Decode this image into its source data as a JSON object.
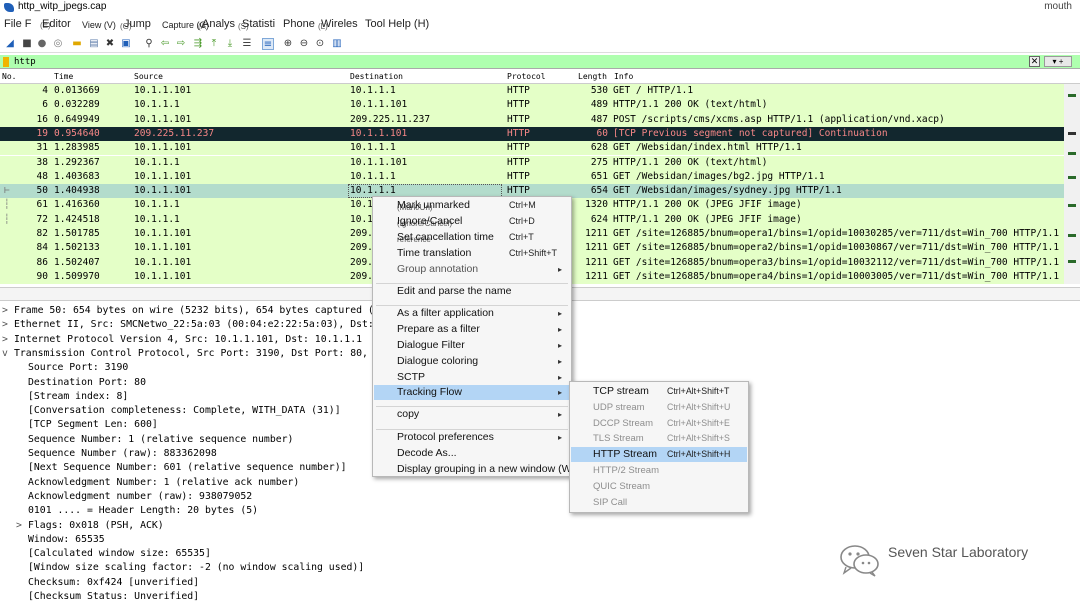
{
  "window": {
    "title": "http_witp_jpegs.cap",
    "right_text": "mouth"
  },
  "menu": [
    "File F",
    "Editor",
    "Jump",
    "Capture (C)",
    "Analys",
    "Statisti",
    "Phone",
    "Wireles",
    "Tool Help (H)"
  ],
  "menu_ghost": [
    "(E)",
    "View (V)",
    "(G)",
    "(A)",
    "(S)",
    "(L)"
  ],
  "filter": {
    "value": "http"
  },
  "columns": {
    "no": "No.",
    "time": "Time",
    "source": "Source",
    "destination": "Destination",
    "protocol": "Protocol",
    "length": "Length",
    "info": "Info"
  },
  "packets": [
    {
      "no": "4",
      "time": "0.013669",
      "src": "10.1.1.101",
      "dst": "10.1.1.1",
      "proto": "HTTP",
      "len": "530",
      "info": "GET / HTTP/1.1"
    },
    {
      "no": "6",
      "time": "0.032289",
      "src": "10.1.1.1",
      "dst": "10.1.1.101",
      "proto": "HTTP",
      "len": "489",
      "info": "HTTP/1.1 200 OK  (text/html)"
    },
    {
      "no": "16",
      "time": "0.649949",
      "src": "10.1.1.101",
      "dst": "209.225.11.237",
      "proto": "HTTP",
      "len": "487",
      "info": "POST /scripts/cms/xcms.asp HTTP/1.1  (application/vnd.xacp)"
    },
    {
      "no": "19",
      "time": "0.954640",
      "src": "209.225.11.237",
      "dst": "10.1.1.101",
      "proto": "HTTP",
      "len": "60",
      "info": "[TCP Previous segment not captured] Continuation"
    },
    {
      "no": "31",
      "time": "1.283985",
      "src": "10.1.1.101",
      "dst": "10.1.1.1",
      "proto": "HTTP",
      "len": "628",
      "info": "GET /Websidan/index.html HTTP/1.1"
    },
    {
      "no": "38",
      "time": "1.292367",
      "src": "10.1.1.1",
      "dst": "10.1.1.101",
      "proto": "HTTP",
      "len": "275",
      "info": "HTTP/1.1 200 OK  (text/html)"
    },
    {
      "no": "48",
      "time": "1.403683",
      "src": "10.1.1.101",
      "dst": "10.1.1.1",
      "proto": "HTTP",
      "len": "651",
      "info": "GET /Websidan/images/bg2.jpg HTTP/1.1"
    },
    {
      "no": "50",
      "time": "1.404938",
      "src": "10.1.1.101",
      "dst": "10.1.1.1",
      "proto": "HTTP",
      "len": "654",
      "info": "GET /Websidan/images/sydney.jpg HTTP/1.1"
    },
    {
      "no": "61",
      "time": "1.416360",
      "src": "10.1.1.1",
      "dst": "10.1",
      "proto": "",
      "len": "1320",
      "info": "HTTP/1.1 200 OK  (JPEG JFIF image)"
    },
    {
      "no": "72",
      "time": "1.424518",
      "src": "10.1.1.1",
      "dst": "10.1",
      "proto": "",
      "len": "624",
      "info": "HTTP/1.1 200 OK  (JPEG JFIF image)"
    },
    {
      "no": "82",
      "time": "1.501785",
      "src": "10.1.1.101",
      "dst": "209.",
      "proto": "",
      "len": "1211",
      "info": "GET /site=126885/bnum=opera1/bins=1/opid=10030285/ver=711/dst=Win_700 HTTP/1.1"
    },
    {
      "no": "84",
      "time": "1.502133",
      "src": "10.1.1.101",
      "dst": "209.",
      "proto": "",
      "len": "1211",
      "info": "GET /site=126885/bnum=opera2/bins=1/opid=10030867/ver=711/dst=Win_700 HTTP/1.1"
    },
    {
      "no": "86",
      "time": "1.502407",
      "src": "10.1.1.101",
      "dst": "209.",
      "proto": "",
      "len": "1211",
      "info": "GET /site=126885/bnum=opera3/bins=1/opid=10032112/ver=711/dst=Win_700 HTTP/1.1"
    },
    {
      "no": "90",
      "time": "1.509970",
      "src": "10.1.1.101",
      "dst": "209.",
      "proto": "",
      "len": "1211",
      "info": "GET /site=126885/bnum=opera4/bins=1/opid=10003005/ver=711/dst=Win_700 HTTP/1.1"
    }
  ],
  "details": [
    {
      "tw": ">",
      "text": "Frame 50: 654 bytes on wire (5232 bits), 654 bytes captured (5.",
      "indent": 0
    },
    {
      "tw": ">",
      "text": "Ethernet II, Src: SMCNetwo_22:5a:03 (00:04:e2:22:5a:03), Dst: N",
      "indent": 0
    },
    {
      "tw": ">",
      "text": "Internet Protocol Version 4, Src: 10.1.1.101, Dst: 10.1.1.1",
      "indent": 0
    },
    {
      "tw": "v",
      "text": "Transmission Control Protocol, Src Port: 3190, Dst Port: 80, Se",
      "indent": 0
    },
    {
      "tw": "",
      "text": "Source Port: 3190",
      "indent": 1
    },
    {
      "tw": "",
      "text": "Destination Port: 80",
      "indent": 1
    },
    {
      "tw": "",
      "text": "[Stream index: 8]",
      "indent": 1
    },
    {
      "tw": "",
      "text": "[Conversation completeness: Complete, WITH_DATA (31)]",
      "indent": 1
    },
    {
      "tw": "",
      "text": "[TCP Segment Len: 600]",
      "indent": 1
    },
    {
      "tw": "",
      "text": "Sequence Number: 1    (relative sequence number)",
      "indent": 1
    },
    {
      "tw": "",
      "text": "Sequence Number (raw): 883362098",
      "indent": 1
    },
    {
      "tw": "",
      "text": "[Next Sequence Number: 601    (relative sequence number)]",
      "indent": 1
    },
    {
      "tw": "",
      "text": "Acknowledgment Number: 1    (relative ack number)",
      "indent": 1
    },
    {
      "tw": "",
      "text": "Acknowledgment number (raw): 938079052",
      "indent": 1
    },
    {
      "tw": "",
      "text": "0101 .... = Header Length: 20 bytes (5)",
      "indent": 1
    },
    {
      "tw": ">",
      "text": "Flags: 0x018 (PSH, ACK)",
      "indent": 1
    },
    {
      "tw": "",
      "text": "Window: 65535",
      "indent": 1
    },
    {
      "tw": "",
      "text": "[Calculated window size: 65535]",
      "indent": 1
    },
    {
      "tw": "",
      "text": "[Window size scaling factor: -2 (no window scaling used)]",
      "indent": 1
    },
    {
      "tw": "",
      "text": "Checksum: 0xf424 [unverified]",
      "indent": 1
    },
    {
      "tw": "",
      "text": "[Checksum Status: Unverified]",
      "indent": 1
    }
  ],
  "context_menu": [
    {
      "label": "Mark unmarked",
      "shortcut": "Ctrl+M"
    },
    {
      "label": "Ignore/Cancel",
      "shortcut": "Ctrl+D"
    },
    {
      "label": "Set cancellation time",
      "shortcut": "Ctrl+T"
    },
    {
      "label": "Time translation",
      "shortcut": "Ctrl+Shift+T"
    },
    {
      "label": "Group annotation",
      "shortcut": "",
      "submenu": true
    },
    {
      "label": "Edit and parse the name",
      "shortcut": ""
    },
    {
      "label": "As a filter application",
      "shortcut": "",
      "submenu": true
    },
    {
      "label": "Prepare as a filter",
      "shortcut": "",
      "submenu": true
    },
    {
      "label": "Dialogue Filter",
      "shortcut": "",
      "submenu": true
    },
    {
      "label": "Dialogue coloring",
      "shortcut": "",
      "submenu": true
    },
    {
      "label": "SCTP",
      "shortcut": "",
      "submenu": true
    },
    {
      "label": "Tracking Flow",
      "shortcut": "",
      "submenu": true
    },
    {
      "label": "copy",
      "shortcut": "",
      "submenu": true
    },
    {
      "label": "Protocol preferences",
      "shortcut": "",
      "submenu": true
    },
    {
      "label": "Decode As...",
      "shortcut": ""
    },
    {
      "label": "Display grouping in a new window (W)",
      "shortcut": ""
    }
  ],
  "context_ghost": [
    "(Mark/Un)",
    "(Ignore/Cancel)",
    "reference"
  ],
  "submenu": [
    {
      "label": "TCP stream",
      "shortcut": "Ctrl+Alt+Shift+T",
      "enabled": true
    },
    {
      "label": "UDP stream",
      "shortcut": "Ctrl+Alt+Shift+U",
      "enabled": false
    },
    {
      "label": "DCCP Stream",
      "shortcut": "Ctrl+Alt+Shift+E",
      "enabled": false
    },
    {
      "label": "TLS Stream",
      "shortcut": "Ctrl+Alt+Shift+S",
      "enabled": false
    },
    {
      "label": "HTTP Stream",
      "shortcut": "Ctrl+Alt+Shift+H",
      "enabled": true
    },
    {
      "label": "HTTP/2 Stream",
      "shortcut": "",
      "enabled": false
    },
    {
      "label": "QUIC Stream",
      "shortcut": "",
      "enabled": false
    },
    {
      "label": "SIP Call",
      "shortcut": "",
      "enabled": false
    }
  ],
  "watermark": {
    "text": "Seven Star Laboratory"
  },
  "colors": {
    "http_row": "#e4ffc7",
    "bad_row_bg": "#12272e",
    "bad_row_fg": "#f78787",
    "selected_row": "#b3dccc",
    "menu_highlight": "#b3d5f5",
    "filter_ok": "#afffaf"
  },
  "toolbar_icons": [
    "shark-start-icon",
    "stop-icon",
    "restart-icon",
    "options-icon",
    "open-icon",
    "save-icon",
    "close-file-icon",
    "reload-icon",
    "find-icon",
    "back-icon",
    "forward-icon",
    "goto-icon",
    "first-icon",
    "last-icon",
    "autoscroll-icon",
    "colorize-icon",
    "zoom-in-icon",
    "zoom-out-icon",
    "zoom-reset-icon",
    "resize-columns-icon"
  ]
}
